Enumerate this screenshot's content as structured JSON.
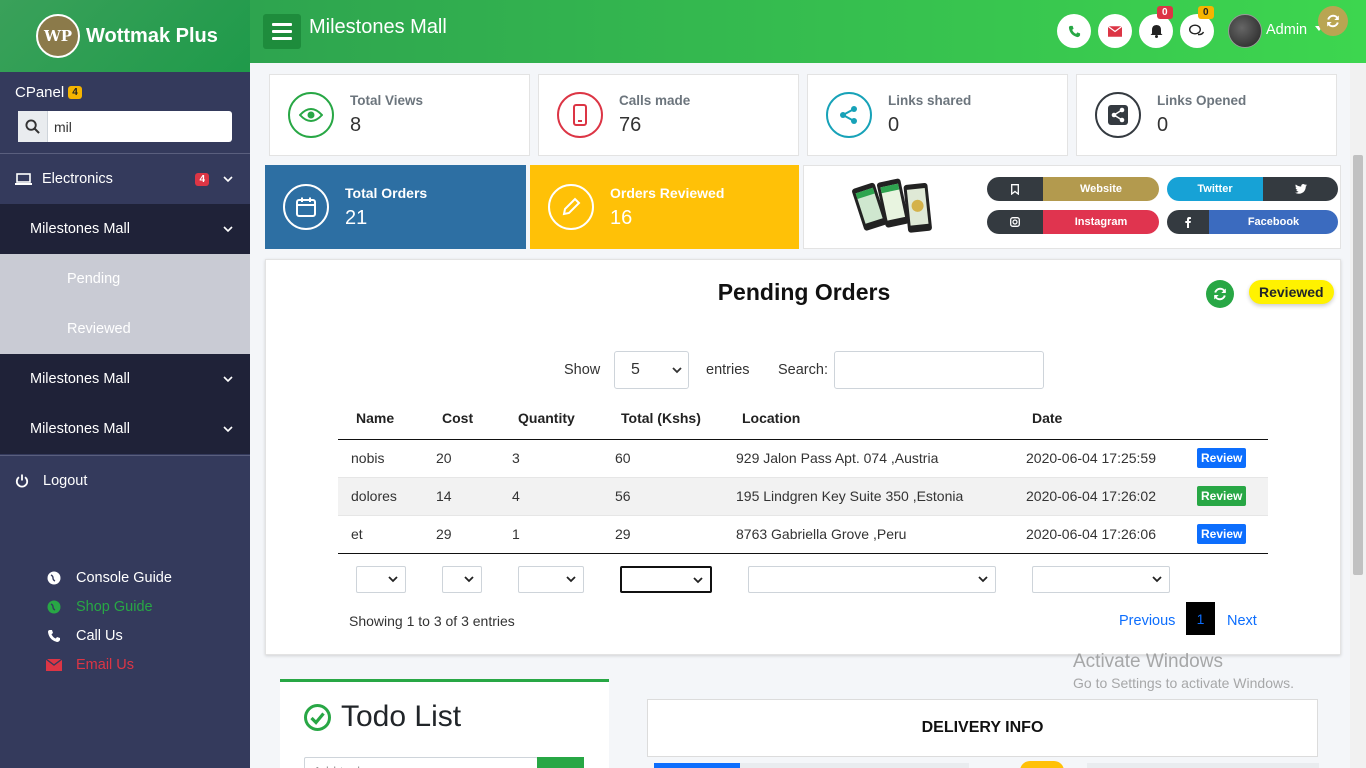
{
  "brand": {
    "logo_text": "WP",
    "name": "Wottmak Plus"
  },
  "sidebar": {
    "cpanel_label": "CPanel",
    "cpanel_badge": "4",
    "search_value": "mil",
    "electronics_label": "Electronics",
    "electronics_badge": "4",
    "mall_1": "Milestones Mall",
    "pending": "Pending",
    "reviewed": "Reviewed",
    "mall_2": "Milestones Mall",
    "mall_3": "Milestones Mall",
    "logout": "Logout",
    "guides": [
      "Console Guide",
      "Shop Guide",
      "Call Us",
      "Email Us"
    ]
  },
  "topbar": {
    "title": "Milestones Mall",
    "notif_badge": "0",
    "messages_badge": "0",
    "admin_label": "Admin"
  },
  "stats": [
    {
      "label": "Total Views",
      "value": "8"
    },
    {
      "label": "Calls made",
      "value": "76"
    },
    {
      "label": "Links shared",
      "value": "0"
    },
    {
      "label": "Links Opened",
      "value": "0"
    }
  ],
  "big_stats": [
    {
      "label": "Total Orders",
      "value": "21"
    },
    {
      "label": "Orders Reviewed",
      "value": "16"
    }
  ],
  "social": {
    "website": "Website",
    "twitter": "Twitter",
    "instagram": "Instagram",
    "facebook": "Facebook"
  },
  "orders": {
    "title": "Pending Orders",
    "reviewed_button": "Reviewed",
    "show_label": "Show",
    "entries_value": "5",
    "entries_label": "entries",
    "search_label": "Search:",
    "columns": [
      "Name",
      "Cost",
      "Quantity",
      "Total (Kshs)",
      "Location",
      "Date",
      ""
    ],
    "rows": [
      {
        "name": "nobis",
        "cost": "20",
        "quantity": "3",
        "total": "60",
        "location": "929 Jalon Pass Apt. 074 ,Austria",
        "date": "2020-06-04 17:25:59",
        "action": "Review"
      },
      {
        "name": "dolores",
        "cost": "14",
        "quantity": "4",
        "total": "56",
        "location": "195 Lindgren Key Suite 350 ,Estonia",
        "date": "2020-06-04 17:26:02",
        "action": "Review"
      },
      {
        "name": "et",
        "cost": "29",
        "quantity": "1",
        "total": "29",
        "location": "8763 Gabriella Grove ,Peru",
        "date": "2020-06-04 17:26:06",
        "action": "Review"
      }
    ],
    "showing_text": "Showing 1 to 3 of 3 entries",
    "prev": "Previous",
    "page": "1",
    "next": "Next"
  },
  "watermark": {
    "line1": "Activate Windows",
    "line2": "Go to Settings to activate Windows."
  },
  "todo": {
    "title": "Todo List",
    "placeholder": "Add task..."
  },
  "delivery": {
    "title": "DELIVERY INFO"
  },
  "colors": {
    "green": "#28a745",
    "blue_card": "#2d6fa3",
    "yellow_card": "#ffc107",
    "sidebar": "#343a5c",
    "review_blue": "#0d6efd"
  }
}
